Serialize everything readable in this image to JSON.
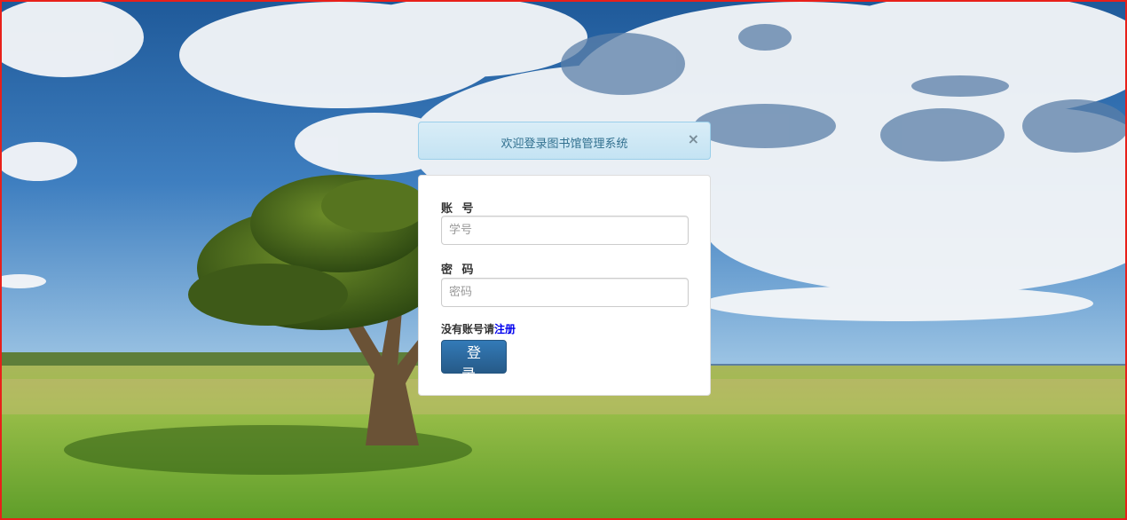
{
  "alert": {
    "message": "欢迎登录图书馆管理系统",
    "close_symbol": "×"
  },
  "form": {
    "account_label": "账 号",
    "account_placeholder": "学号",
    "password_label": "密 码",
    "password_placeholder": "密码",
    "no_account_text": "没有账号请",
    "register_link": "注册",
    "login_button": "登 录"
  },
  "colors": {
    "frame_border": "#e8201a",
    "alert_bg": "#d9edf7",
    "alert_text": "#31708f",
    "button_primary": "#2e6da4",
    "link": "#0000ee"
  }
}
